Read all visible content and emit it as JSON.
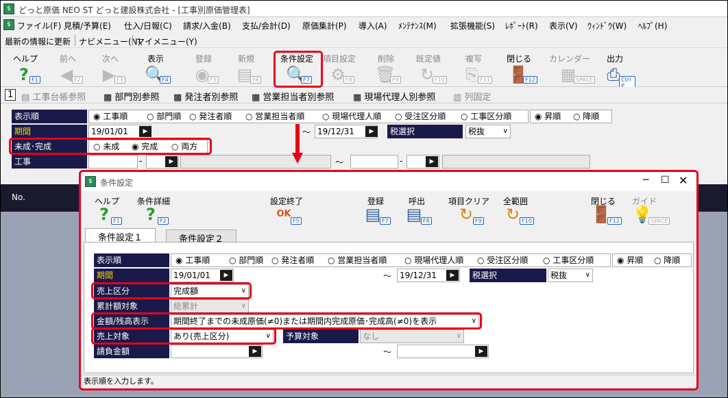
{
  "window": {
    "title": "どっと原価 NEO ST どっと建設株式会社 - [工事別原価管理表]"
  },
  "menu": [
    "ファイル(F)",
    "見積/予算(E)",
    "仕入/日報(C)",
    "請求/入金(B)",
    "支払/会計(D)",
    "原価集計(P)",
    "導入(A)",
    "ﾒﾝﾃﾅﾝｽ(M)",
    "拡張機能(S)",
    "ﾚﾎﾟｰﾄ(R)",
    "表示(V)",
    "ｳｨﾝﾄﾞｳ(W)",
    "ﾍﾙﾌﾟ(H)"
  ],
  "subbar": [
    "最新の情報に更新",
    "ナビメニュー(N)",
    "マイメニュー(Y)"
  ],
  "toolbar": [
    {
      "label": "ヘルプ",
      "key": "F1",
      "icon": "help-icon",
      "glyph": "?",
      "enabled": true
    },
    {
      "label": "前へ",
      "key": "F2",
      "icon": "back-arrow-icon",
      "glyph": "◀",
      "enabled": false
    },
    {
      "label": "次へ",
      "key": "F3",
      "icon": "forward-arrow-icon",
      "glyph": "▶",
      "enabled": false
    },
    {
      "label": "表示",
      "key": "F4",
      "icon": "magnifier-icon",
      "glyph": "🔍",
      "enabled": true
    },
    {
      "label": "登録",
      "key": "F5",
      "icon": "ok-icon",
      "glyph": "◉",
      "enabled": false
    },
    {
      "label": "新規",
      "key": "F6",
      "icon": "document-icon",
      "glyph": "▤",
      "enabled": false
    },
    {
      "label": "条件設定",
      "key": "F7",
      "icon": "condition-icon",
      "glyph": "🔍",
      "enabled": true
    },
    {
      "label": "項目設定",
      "key": "F8",
      "icon": "gear-icon",
      "glyph": "⚙",
      "enabled": false
    },
    {
      "label": "削除",
      "key": "F9",
      "icon": "trash-icon",
      "glyph": "🗑",
      "enabled": false
    },
    {
      "label": "既定値",
      "key": "F10",
      "icon": "refresh-icon",
      "glyph": "↻",
      "enabled": false
    },
    {
      "label": "複写",
      "key": "F11",
      "icon": "copy-icon",
      "glyph": "⎘",
      "enabled": false
    },
    {
      "label": "閉じる",
      "key": "F12",
      "icon": "door-icon",
      "glyph": "🚪",
      "enabled": true
    },
    {
      "label": "カレンダー",
      "key": "SPACE",
      "icon": "calendar-icon",
      "glyph": "▦",
      "enabled": false
    },
    {
      "label": "出力",
      "key": "Ctrl P",
      "icon": "printer-icon",
      "glyph": "⎙",
      "enabled": true
    }
  ],
  "views": [
    "1",
    "工事台帳参照",
    "部門別参照",
    "発注者別参照",
    "営業担当者別参照",
    "現場代理人別参照",
    "列固定"
  ],
  "main_form": {
    "order_label": "表示順",
    "order_options": [
      "工事順",
      "部門順",
      "発注者順",
      "営業担当者順",
      "現場代理人順",
      "受注区分順",
      "工事区分順"
    ],
    "sort_options": [
      "昇順",
      "降順"
    ],
    "period_label": "期間",
    "period_from": "19/01/01",
    "period_to": "19/12/31",
    "tax_label": "税選択",
    "tax_value": "税抜",
    "status_label": "未成･完成",
    "status_options": [
      "未成",
      "完成",
      "両方"
    ],
    "project_label": "工事",
    "tilde": "～",
    "dash": "-"
  },
  "grid": {
    "no_header": "No."
  },
  "dialog": {
    "title": "条件設定",
    "toolbar": [
      {
        "label": "ヘルプ",
        "key": "F1",
        "icon": "help-icon",
        "glyph": "?",
        "enabled": true
      },
      {
        "label": "条件詳細",
        "key": "F2",
        "icon": "help-detail-icon",
        "glyph": "?",
        "enabled": true
      },
      {
        "label": "設定終了",
        "key": "F5",
        "icon": "ok-icon",
        "glyph": "OK",
        "enabled": true
      },
      {
        "label": "登録",
        "key": "F7",
        "icon": "save-icon",
        "glyph": "▤",
        "enabled": true
      },
      {
        "label": "呼出",
        "key": "F8",
        "icon": "load-icon",
        "glyph": "▤",
        "enabled": true
      },
      {
        "label": "項目クリア",
        "key": "F9",
        "icon": "clear-icon",
        "glyph": "↻",
        "enabled": true
      },
      {
        "label": "全範囲",
        "key": "F10",
        "icon": "all-range-icon",
        "glyph": "↻",
        "enabled": true
      },
      {
        "label": "閉じる",
        "key": "F12",
        "icon": "door-icon",
        "glyph": "🚪",
        "enabled": true
      },
      {
        "label": "ガイド",
        "key": "SPACE",
        "icon": "bulb-icon",
        "glyph": "💡",
        "enabled": false
      }
    ],
    "tabs": [
      "条件設定１",
      "条件設定２"
    ],
    "order_label": "表示順",
    "period_label": "期間",
    "period_from": "19/01/01",
    "period_to": "19/12/31",
    "tax_label": "税選択",
    "tax_value": "税抜",
    "sales_div_label": "売上区分",
    "sales_div_value": "完成額",
    "cumulative_label": "累計額対象",
    "cumulative_value": "総累計",
    "amount_label": "金額/残高表示",
    "amount_value": "期間終了までの未成原価(≠0)または期間内完成原価･完成高(≠0)を表示",
    "sales_target_label": "売上対象",
    "sales_target_value": "あり(売上区分)",
    "budget_label": "予算対象",
    "budget_value": "なし",
    "contract_label": "請負金額",
    "status_text": "表示順を入力します。"
  }
}
